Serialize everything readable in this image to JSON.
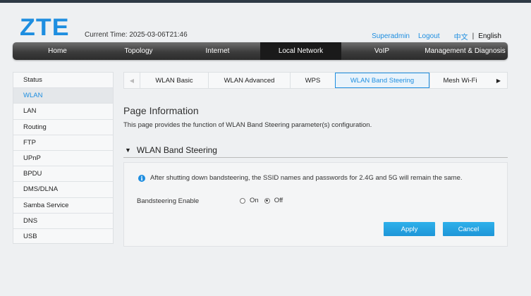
{
  "header": {
    "logo": "ZTE",
    "current_time_label": "Current Time: 2025-03-06T21:46",
    "user_link": "Superadmin",
    "logout_link": "Logout",
    "lang_chinese": "中文",
    "lang_separator": "|",
    "lang_english": "English"
  },
  "nav": {
    "items": [
      {
        "label": "Home"
      },
      {
        "label": "Topology"
      },
      {
        "label": "Internet"
      },
      {
        "label": "Local Network"
      },
      {
        "label": "VoIP"
      },
      {
        "label": "Management & Diagnosis"
      }
    ],
    "active": "Local Network"
  },
  "sidebar": {
    "items": [
      {
        "label": "Status"
      },
      {
        "label": "WLAN"
      },
      {
        "label": "LAN"
      },
      {
        "label": "Routing"
      },
      {
        "label": "FTP"
      },
      {
        "label": "UPnP"
      },
      {
        "label": "BPDU"
      },
      {
        "label": "DMS/DLNA"
      },
      {
        "label": "Samba Service"
      },
      {
        "label": "DNS"
      },
      {
        "label": "USB"
      }
    ],
    "active": "WLAN"
  },
  "tabs": {
    "items": [
      {
        "label": "WLAN Basic"
      },
      {
        "label": "WLAN Advanced"
      },
      {
        "label": "WPS"
      },
      {
        "label": "WLAN Band Steering"
      },
      {
        "label": "Mesh Wi-Fi"
      }
    ],
    "active": "WLAN Band Steering",
    "left_arrow": "◀",
    "right_arrow": "▶"
  },
  "page": {
    "title": "Page Information",
    "description": "This page provides the function of WLAN Band Steering parameter(s) configuration."
  },
  "section": {
    "toggle_glyph": "▼",
    "title": "WLAN Band Steering",
    "info_icon": "i",
    "info_text": "After shutting down bandsteering, the SSID names and passwords for 2.4G and 5G will remain the same.",
    "field_label": "Bandsteering Enable",
    "option_on": "On",
    "option_off": "Off",
    "selected": "Off",
    "apply_label": "Apply",
    "cancel_label": "Cancel"
  },
  "colors": {
    "accent": "#1e8ee0",
    "button": "#1e96d8",
    "navbar": "#3c3c3c",
    "navbar_active": "#1a1a1a"
  }
}
